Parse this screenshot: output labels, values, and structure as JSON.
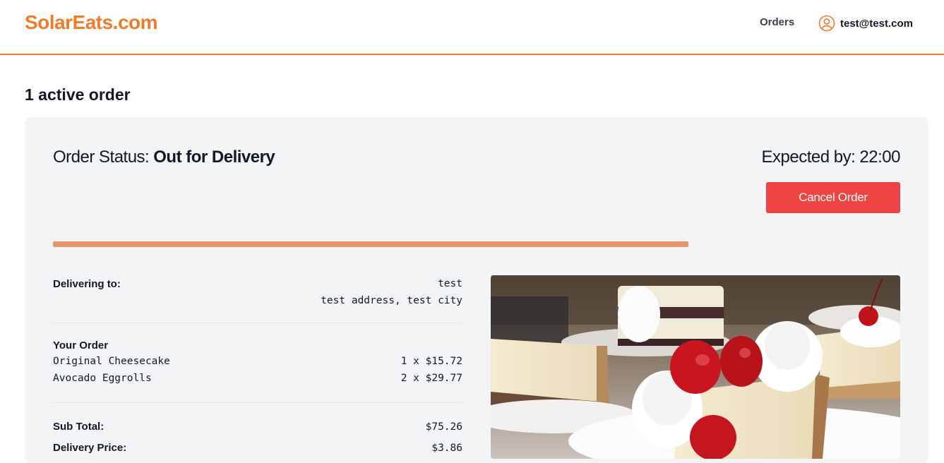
{
  "header": {
    "logo": "SolarEats.com",
    "nav_orders": "Orders",
    "account_email": "test@test.com",
    "account_icon": "user-circle-icon"
  },
  "main": {
    "heading": "1 active order"
  },
  "order": {
    "status_label": "Order Status:",
    "status_value": "Out for Delivery",
    "expected": "Expected by: 22:00",
    "cancel_label": "Cancel Order",
    "progress": 0.75,
    "progress_color": "#e9956b",
    "delivering_label": "Delivering to:",
    "recipient": "test",
    "address": "test address, test city",
    "your_order_label": "Your Order",
    "items": [
      {
        "name": "Original Cheesecake",
        "qty_price": "1 x $15.72"
      },
      {
        "name": "Avocado Eggrolls",
        "qty_price": "2 x $29.77"
      }
    ],
    "subtotal_label": "Sub Total:",
    "subtotal_value": "$75.26",
    "delivery_label": "Delivery Price:",
    "delivery_value": "$3.86"
  },
  "colors": {
    "brand": "#f07b2a",
    "cancel": "#ef4444",
    "card_bg": "#f3f4f6"
  }
}
